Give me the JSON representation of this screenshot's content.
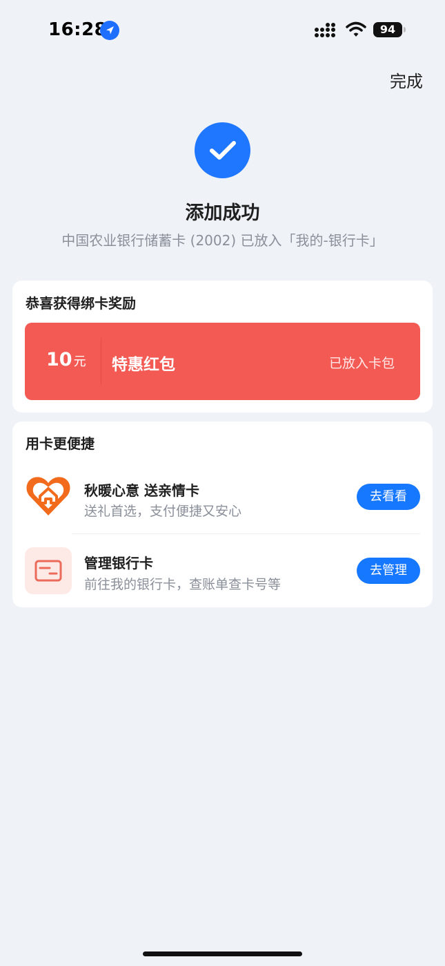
{
  "status_bar": {
    "time": "16:28",
    "battery": "94",
    "icons": [
      "location-arrow-icon",
      "cellular-signal-icon",
      "wifi-icon",
      "battery-icon"
    ]
  },
  "header": {
    "done_label": "完成"
  },
  "result": {
    "title": "添加成功",
    "subtitle": "中国农业银行储蓄卡 (2002) 已放入「我的-银行卡」",
    "accent": "#1f76ff"
  },
  "reward_card": {
    "title": "恭喜获得绑卡奖励",
    "amount": "10",
    "unit": "元",
    "name": "特惠红包",
    "status": "已放入卡包",
    "color": "#f45a54"
  },
  "convenience": {
    "title": "用卡更便捷",
    "items": [
      {
        "icon": "heart-house-icon",
        "title": "秋暖心意 送亲情卡",
        "desc": "送礼首选，支付便捷又安心",
        "button": "去看看"
      },
      {
        "icon": "bank-card-icon",
        "title": "管理银行卡",
        "desc": "前往我的银行卡，查账单查卡号等",
        "button": "去管理"
      }
    ],
    "button_color": "#1677ff"
  }
}
